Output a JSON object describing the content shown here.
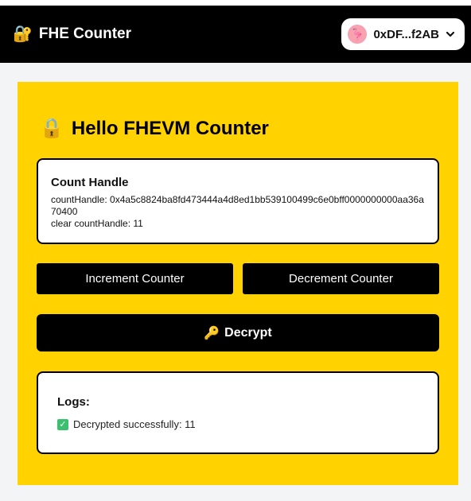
{
  "header": {
    "lock_icon": "🔐",
    "title": "FHE Counter",
    "wallet": {
      "avatar_icon": "🦩",
      "address": "0xDF...f2AB"
    }
  },
  "panel": {
    "title_icon": "🔒",
    "title": "Hello FHEVM Counter",
    "handle_card": {
      "heading": "Count Handle",
      "count_handle": "countHandle: 0x4a5c8824ba8fd473444a4d8ed1bb539100499c6e0bff0000000000aa36a70400",
      "clear_count": "clear countHandle: 11"
    },
    "buttons": {
      "increment": "Increment Counter",
      "decrement": "Decrement Counter",
      "decrypt_icon": "🔑",
      "decrypt": "Decrypt"
    },
    "logs": {
      "heading": "Logs:",
      "entries": [
        {
          "icon": "✓",
          "text": "Decrypted successfully: 11"
        }
      ]
    }
  },
  "colors": {
    "header_bg": "#000000",
    "panel_bg": "#ffd200",
    "page_bg": "#f3f4f6",
    "success": "#3cbf6e"
  }
}
